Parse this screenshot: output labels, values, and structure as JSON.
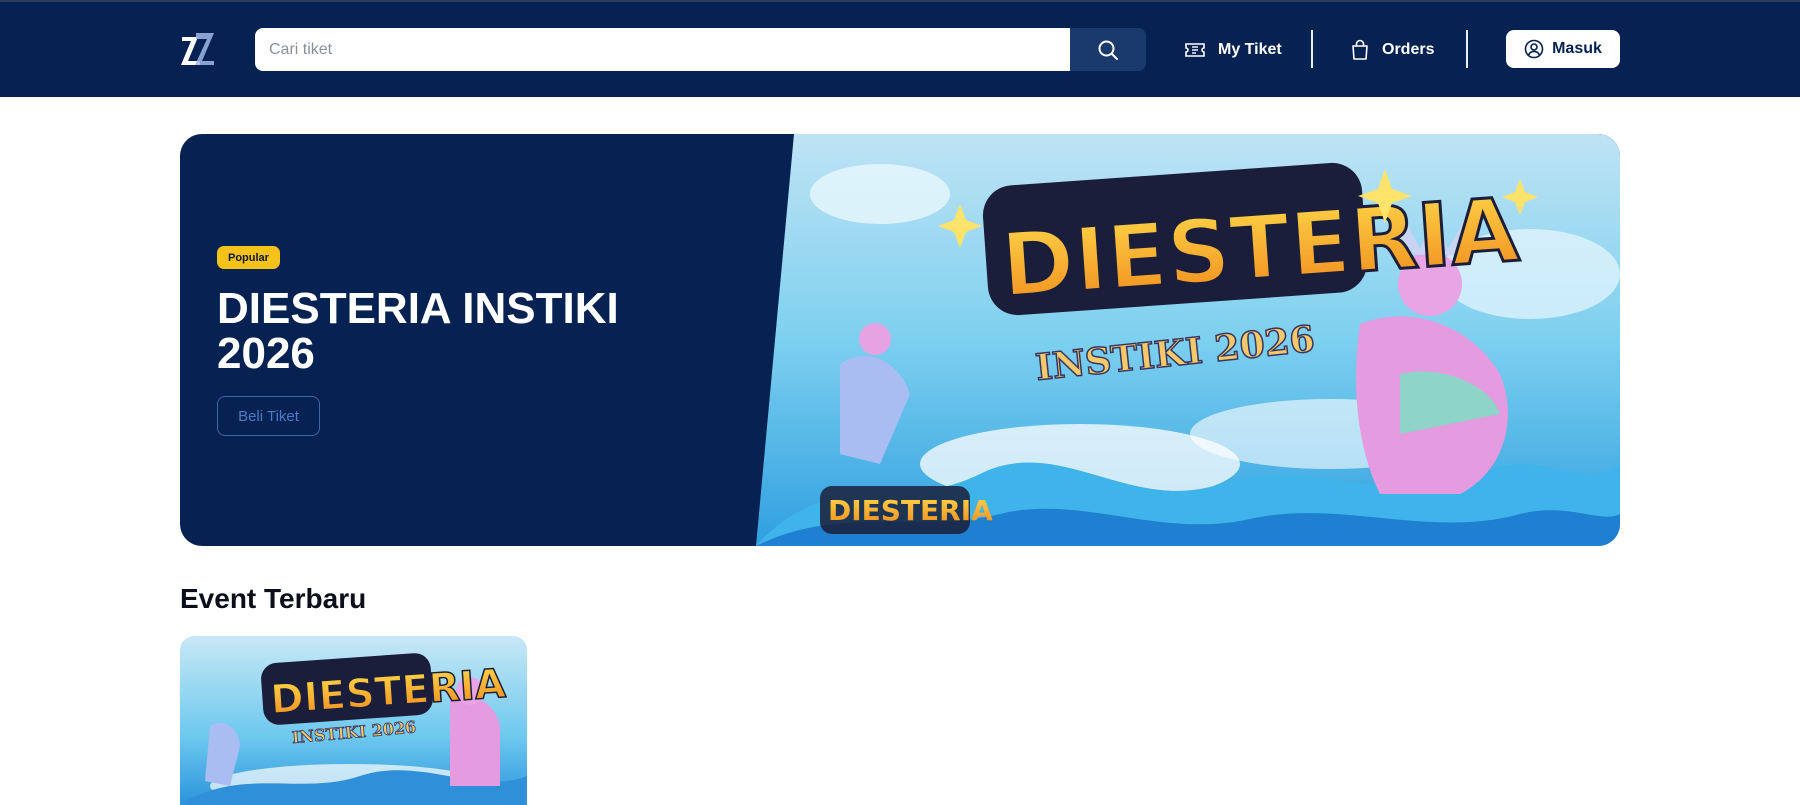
{
  "header": {
    "logo_icon": "zz-logo-icon",
    "search": {
      "placeholder": "Cari tiket",
      "value": ""
    },
    "nav": {
      "my_ticket": "My Tiket",
      "orders": "Orders",
      "login": "Masuk"
    }
  },
  "hero": {
    "badge": "Popular",
    "title": "DIESTERIA INSTIKI 2026",
    "button": "Beli Tiket",
    "art_text": {
      "main": "DIESTERIA",
      "sub": "INSTIKI 2026"
    }
  },
  "events": {
    "section_title": "Event Terbaru",
    "items": [
      {
        "art_main": "DIESTERIA",
        "art_sub": "INSTIKI 2026"
      }
    ]
  },
  "colors": {
    "navy": "#062253",
    "badge_yellow": "#f5c21a",
    "search_button": "#1a3a6e"
  }
}
